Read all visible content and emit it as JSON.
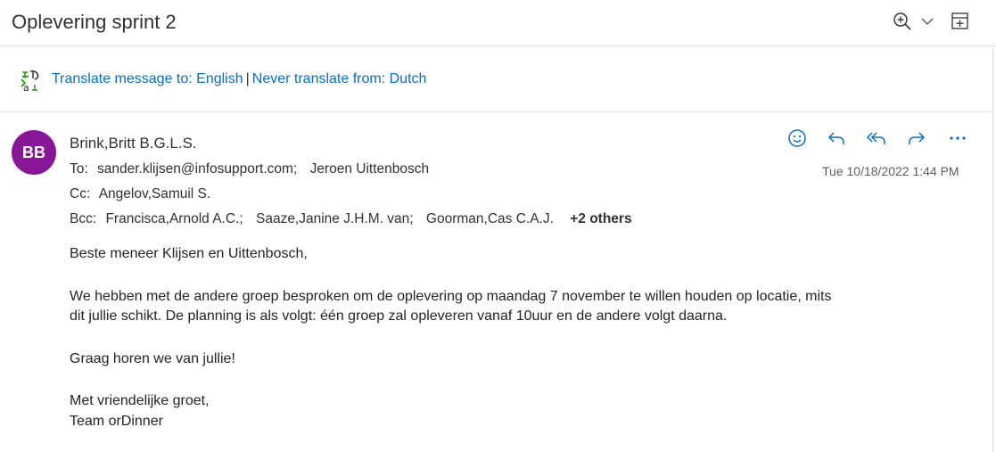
{
  "subject": "Oplevering sprint 2",
  "header_icons": [
    "zoom-icon",
    "chevron-down-icon",
    "popout-icon"
  ],
  "translate": {
    "icon": "translate-icon",
    "translate_link": "Translate message to: English",
    "separator": "|",
    "never_link": "Never translate from: Dutch"
  },
  "sender": {
    "initials": "BB",
    "avatar_color": "#881798",
    "name": "Brink,Britt B.G.L.S."
  },
  "recipients": {
    "to_label": "To:",
    "to": [
      "sander.klijsen@infosupport.com;",
      "Jeroen Uittenbosch"
    ],
    "cc_label": "Cc:",
    "cc": [
      "Angelov,Samuil S."
    ],
    "bcc_label": "Bcc:",
    "bcc": [
      "Francisca,Arnold A.C.;",
      "Saaze,Janine J.H.M. van;",
      "Goorman,Cas C.A.J."
    ],
    "bcc_more": "+2 others"
  },
  "date": "Tue 10/18/2022 1:44 PM",
  "actions": [
    "emoji-icon",
    "reply-icon",
    "reply-all-icon",
    "forward-icon",
    "more-icon"
  ],
  "accent_color": "#0f6cbd",
  "body": {
    "greeting": "Beste meneer Klijsen en Uittenbosch,",
    "paragraph1_line1": "We hebben met de andere groep besproken om de oplevering op maandag 7 november te willen houden op locatie, mits",
    "paragraph1_line2": "dit jullie schikt. De planning is als volgt: één groep zal opleveren vanaf 10uur en de andere volgt daarna.",
    "paragraph2": "Graag horen we van jullie!",
    "closing": "Met vriendelijke groet,",
    "signature": "Team orDinner"
  }
}
